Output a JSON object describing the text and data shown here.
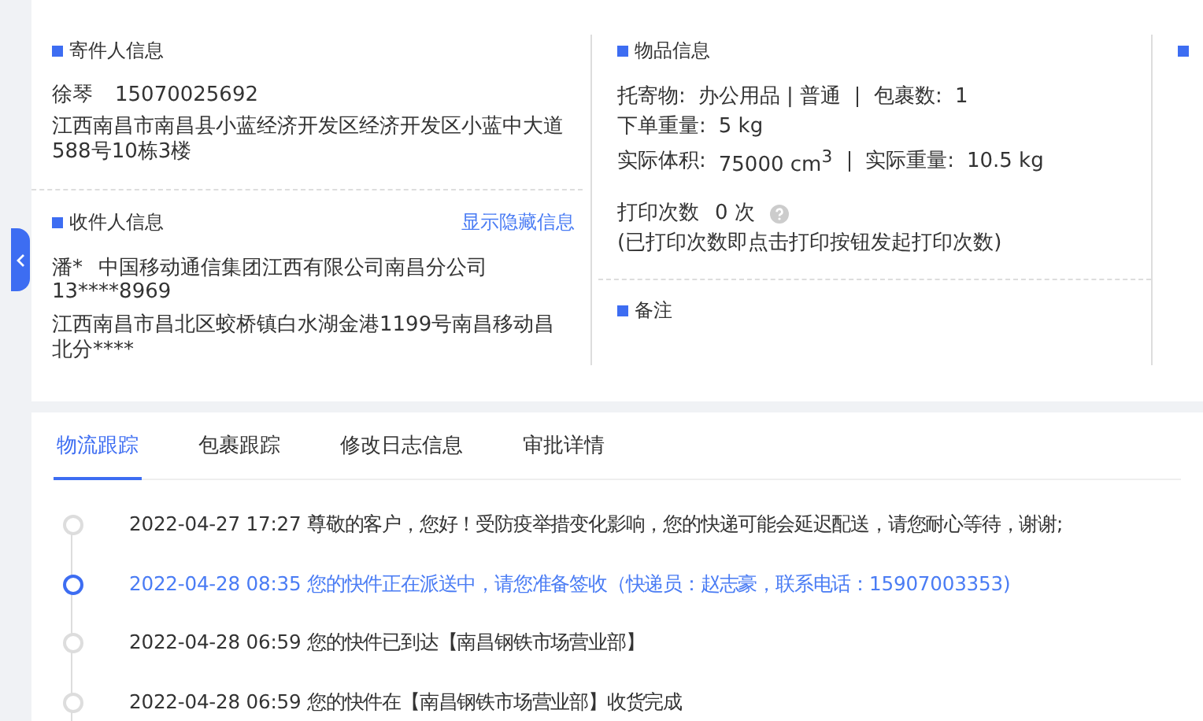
{
  "sender": {
    "title": "寄件人信息",
    "name": "徐琴",
    "phone": "15070025692",
    "address": "江西南昌市南昌县小蓝经济开发区经济开发区小蓝中大道588号10栋3楼"
  },
  "receiver": {
    "title": "收件人信息",
    "toggle_link": "显示隐藏信息",
    "name": "潘*",
    "company": "中国移动通信集团江西有限公司南昌分公司",
    "phone": "13****8969",
    "address": "江西南昌市昌北区蛟桥镇白水湖金港1199号南昌移动昌北分****"
  },
  "goods": {
    "title": "物品信息",
    "lines": [
      [
        {
          "label": "托寄物:",
          "value": "办公用品 | 普通"
        },
        {
          "label": "包裹数:",
          "value": "1"
        }
      ],
      [
        {
          "label": "下单重量:",
          "value": "5 kg"
        }
      ],
      [
        {
          "label": "实际体积:",
          "value": "75000 cm$^{3}$"
        },
        {
          "label": "实际重量:",
          "value": "10.5 kg"
        }
      ]
    ],
    "print_label": "打印次数",
    "print_value": "0 次",
    "print_note": "(已打印次数即点击打印按钮发起打印次数)"
  },
  "remark": {
    "title": "备注"
  },
  "tabs": [
    {
      "label": "物流跟踪",
      "selected": true
    },
    {
      "label": "包裹跟踪",
      "selected": false
    },
    {
      "label": "修改日志信息",
      "selected": false
    },
    {
      "label": "审批详情",
      "selected": false
    }
  ],
  "timeline": [
    {
      "time": "2022-04-27 17:27",
      "text": "尊敬的客户，您好！受防疫举措变化影响，您的快递可能会延迟配送，请您耐心等待，谢谢;",
      "active": false
    },
    {
      "time": "2022-04-28 08:35",
      "text": "您的快件正在派送中，请您准备签收（快递员：赵志豪，联系电话：15907003353)",
      "active": true
    },
    {
      "time": "2022-04-28 06:59",
      "text": "您的快件已到达【南昌钢铁市场营业部】",
      "active": false
    },
    {
      "time": "2022-04-28 06:59",
      "text": "您的快件在【南昌钢铁市场营业部】收货完成",
      "active": false
    }
  ]
}
